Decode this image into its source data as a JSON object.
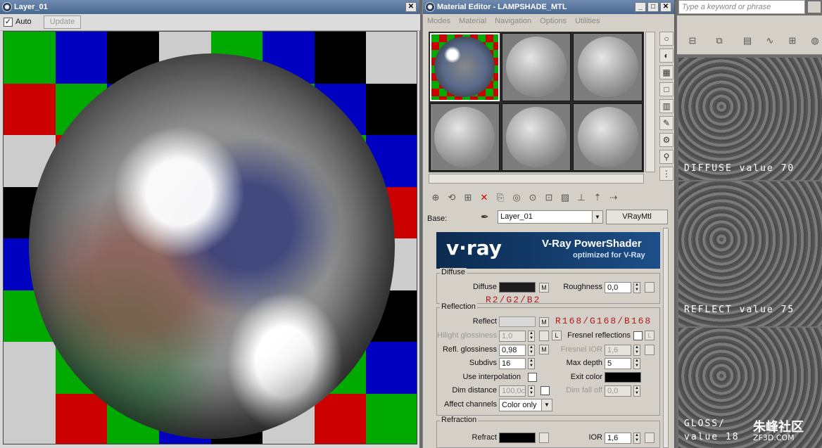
{
  "left_window": {
    "title": "Layer_01",
    "auto_label": "Auto",
    "update_label": "Update"
  },
  "material_editor": {
    "title": "Material Editor - LAMPSHADE_MTL",
    "menu": [
      "Modes",
      "Material",
      "Navigation",
      "Options",
      "Utilities"
    ],
    "base_label": "Base:",
    "material_name": "Layer_01",
    "material_type": "VRayMtl",
    "banner_logo": "v·ray",
    "banner_title": "V-Ray PowerShader",
    "banner_subtitle": "optimized for V-Ray",
    "diffuse": {
      "group_title": "Diffuse",
      "diffuse_label": "Diffuse",
      "roughness_label": "Roughness",
      "roughness_value": "0,0",
      "note": "R2/G2/B2"
    },
    "reflection": {
      "group_title": "Reflection",
      "reflect_label": "Reflect",
      "note": "R168/G168/B168",
      "hilight_label": "Hilight glossiness",
      "hilight_value": "1,0",
      "fresnel_label": "Fresnel reflections",
      "l_label": "L",
      "refl_gloss_label": "Refl. glossiness",
      "refl_gloss_value": "0,98",
      "fresnel_ior_label": "Fresnel IOR",
      "fresnel_ior_value": "1,6",
      "subdivs_label": "Subdivs",
      "subdivs_value": "16",
      "max_depth_label": "Max depth",
      "max_depth_value": "5",
      "interp_label": "Use interpolation",
      "exit_color_label": "Exit color",
      "dim_distance_label": "Dim distance",
      "dim_distance_value": "100,0c",
      "dim_falloff_label": "Dim fall off",
      "dim_falloff_value": "0,0",
      "affect_label": "Affect channels",
      "affect_value": "Color only"
    },
    "refraction": {
      "group_title": "Refraction",
      "refract_label": "Refract",
      "ior_label": "IOR",
      "ior_value": "1,6"
    },
    "m_label": "M"
  },
  "right_panel": {
    "search_placeholder": "Type a keyword or phrase",
    "labels": {
      "diffuse": "DIFFUSE value 70",
      "reflect": "REFLECT value 75",
      "gloss": "GLOSS/",
      "gloss_value": "value 18"
    },
    "watermark": "朱峰社区",
    "watermark_url": "ZF3D.COM"
  },
  "colors": {
    "diffuse_swatch": "#1e1e1e",
    "reflect_swatch": "#d8d8d8",
    "exit_swatch": "#000000",
    "refract_swatch": "#000000"
  }
}
